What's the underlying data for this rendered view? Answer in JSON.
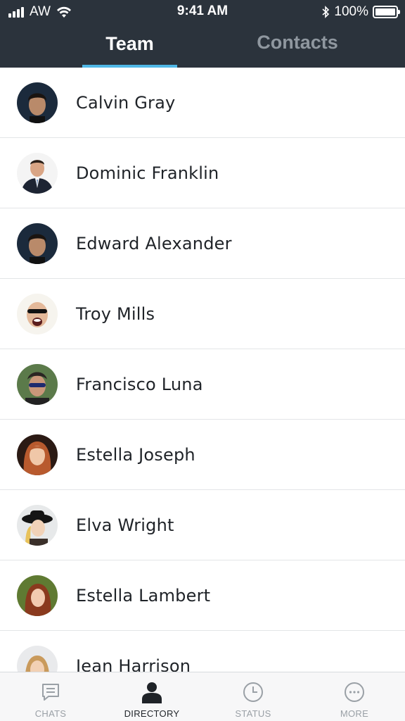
{
  "status_bar": {
    "carrier": "AW",
    "time": "9:41 AM",
    "battery_percent": "100%",
    "battery_level": 1.0
  },
  "tabs": [
    {
      "label": "Team",
      "active": true
    },
    {
      "label": "Contacts",
      "active": false
    }
  ],
  "contacts": [
    {
      "name": "Calvin Gray",
      "avatar": "avatar-man-dark-hair"
    },
    {
      "name": "Dominic Franklin",
      "avatar": "avatar-man-suit"
    },
    {
      "name": "Edward Alexander",
      "avatar": "avatar-man-dark-hair"
    },
    {
      "name": "Troy Mills",
      "avatar": "avatar-bald-man-sunglasses"
    },
    {
      "name": "Francisco Luna",
      "avatar": "avatar-man-sunglasses"
    },
    {
      "name": "Estella Joseph",
      "avatar": "avatar-woman-auburn-hair"
    },
    {
      "name": "Elva Wright",
      "avatar": "avatar-woman-hat"
    },
    {
      "name": "Estella Lambert",
      "avatar": "avatar-woman-red-hair"
    },
    {
      "name": "Jean Harrison",
      "avatar": "avatar-woman-blonde"
    }
  ],
  "bottom_nav": [
    {
      "label": "CHATS",
      "icon": "chat-bubble-icon",
      "active": false
    },
    {
      "label": "DIRECTORY",
      "icon": "person-icon",
      "active": true
    },
    {
      "label": "STATUS",
      "icon": "clock-icon",
      "active": false
    },
    {
      "label": "MORE",
      "icon": "more-dots-icon",
      "active": false
    }
  ],
  "colors": {
    "header_bg": "#2b333c",
    "tab_indicator": "#4fb7e6",
    "text_primary": "#1f2328",
    "text_muted": "#9aa0a6"
  }
}
